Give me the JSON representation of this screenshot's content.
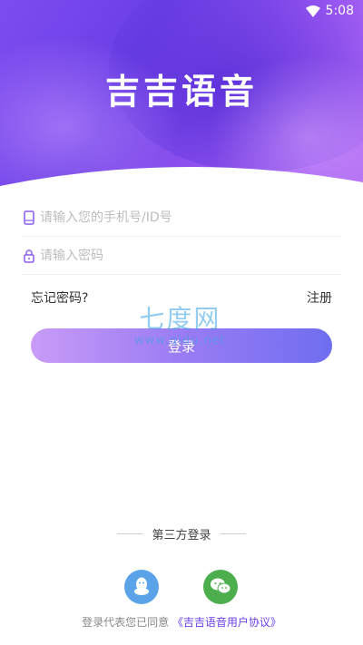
{
  "status_bar": {
    "time": "5:08"
  },
  "app": {
    "title": "吉吉语音"
  },
  "form": {
    "phone_placeholder": "请输入您的手机号/ID号",
    "password_placeholder": "请输入密码",
    "forgot_label": "忘记密码?",
    "register_label": "注册",
    "login_label": "登录"
  },
  "watermark": {
    "big": "七度网",
    "small": "www.qidu.net"
  },
  "third_party": {
    "title": "第三方登录",
    "providers": [
      {
        "icon": "qq-icon",
        "color": "#5aa3e8"
      },
      {
        "icon": "wechat-icon",
        "color": "#4cae4c"
      }
    ]
  },
  "agreement": {
    "prefix": "登录代表您已同意",
    "link": "《吉吉语音用户协议》"
  },
  "colors": {
    "accent": "#6a3fe6",
    "button_start": "#c89bf7",
    "button_end": "#6f6ef0"
  }
}
